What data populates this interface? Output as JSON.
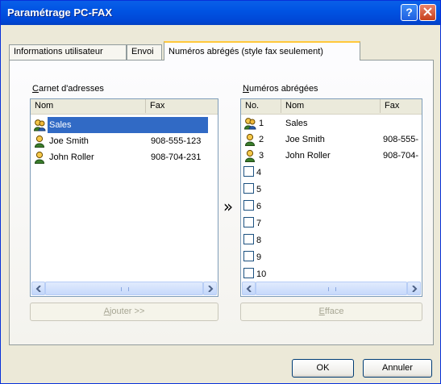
{
  "window": {
    "title": "Paramétrage PC-FAX"
  },
  "title_buttons": {
    "help": "help-button",
    "close": "close-button"
  },
  "tabs": [
    {
      "label": "Informations utilisateur"
    },
    {
      "label": "Envoi"
    },
    {
      "label": "Numéros abrégés (style fax seulement)"
    }
  ],
  "address_book": {
    "label_first": "C",
    "label_rest": "arnet d'adresses",
    "columns": [
      "Nom",
      "Fax"
    ],
    "rows": [
      {
        "icon": "group-icon",
        "name": "Sales",
        "fax": "",
        "selected": true
      },
      {
        "icon": "person-icon",
        "name": "Joe Smith",
        "fax": "908-555-123",
        "selected": false
      },
      {
        "icon": "person-icon",
        "name": "John Roller",
        "fax": "908-704-231",
        "selected": false
      }
    ],
    "add_button_first": "A",
    "add_button_rest": "jouter >>"
  },
  "transfer_arrow": "»",
  "speed_dial": {
    "label_first": "N",
    "label_rest": "uméros abrégées",
    "columns": [
      "No.",
      "Nom",
      "Fax"
    ],
    "rows": [
      {
        "no": "1",
        "icon": "group-icon",
        "name": "Sales",
        "fax": ""
      },
      {
        "no": "2",
        "icon": "person-icon",
        "name": "Joe Smith",
        "fax": "908-555-"
      },
      {
        "no": "3",
        "icon": "person-icon",
        "name": "John Roller",
        "fax": "908-704-"
      },
      {
        "no": "4",
        "icon": "",
        "name": "",
        "fax": ""
      },
      {
        "no": "5",
        "icon": "",
        "name": "",
        "fax": ""
      },
      {
        "no": "6",
        "icon": "",
        "name": "",
        "fax": ""
      },
      {
        "no": "7",
        "icon": "",
        "name": "",
        "fax": ""
      },
      {
        "no": "8",
        "icon": "",
        "name": "",
        "fax": ""
      },
      {
        "no": "9",
        "icon": "",
        "name": "",
        "fax": ""
      },
      {
        "no": "10",
        "icon": "",
        "name": "",
        "fax": ""
      }
    ],
    "delete_button_first": "E",
    "delete_button_rest": "fface"
  },
  "footer": {
    "ok_label": "OK",
    "cancel_label": "Annuler"
  },
  "colors": {
    "titlebar": "#0054e3",
    "selection": "#316ac5",
    "tab_highlight": "#ffc83c",
    "dialog_bg": "#ece9d8"
  }
}
